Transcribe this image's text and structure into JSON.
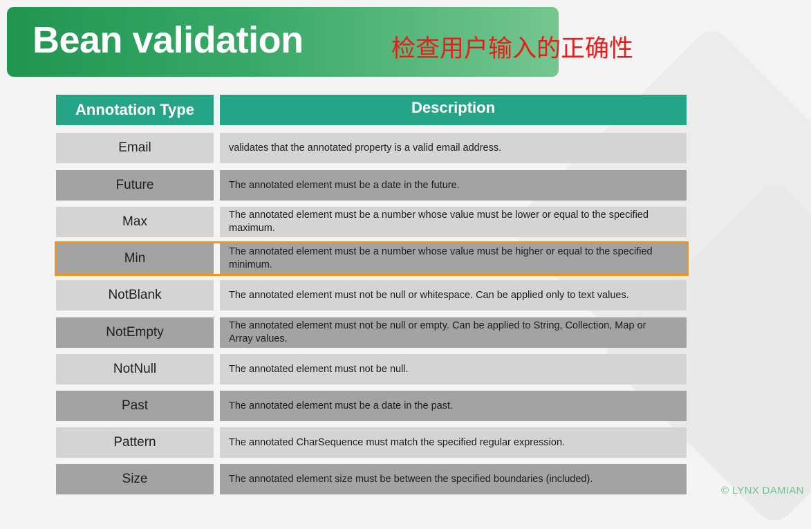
{
  "slide": {
    "title": "Bean validation",
    "subtitle": "检查用户输入的正确性",
    "watermark": "© LYNX DAMIAN",
    "accent_color": "#26a487",
    "highlight_color": "#f5950e"
  },
  "table": {
    "headers": {
      "type": "Annotation Type",
      "description": "Description"
    },
    "highlighted_row": "Min",
    "rows": [
      {
        "type": "Email",
        "description": "validates that the annotated property is a valid email address."
      },
      {
        "type": "Future",
        "description": "The annotated element must be a date in the future."
      },
      {
        "type": "Max",
        "description": "The annotated element must be a number whose value must be lower or equal to the specified maximum."
      },
      {
        "type": "Min",
        "description": "The annotated element must be a number whose value must be higher or equal to the specified minimum."
      },
      {
        "type": "NotBlank",
        "description": "The annotated element must not be null or whitespace. Can be applied only to text values."
      },
      {
        "type": "NotEmpty",
        "description": "The annotated element must not be null or empty. Can be applied to String, Collection, Map or Array values."
      },
      {
        "type": "NotNull",
        "description": "The annotated element must not be null."
      },
      {
        "type": "Past",
        "description": "The annotated element must be a date in the past."
      },
      {
        "type": "Pattern",
        "description": "The annotated CharSequence must match the specified regular expression."
      },
      {
        "type": "Size",
        "description": "The annotated element size must be between the specified boundaries (included)."
      }
    ]
  }
}
